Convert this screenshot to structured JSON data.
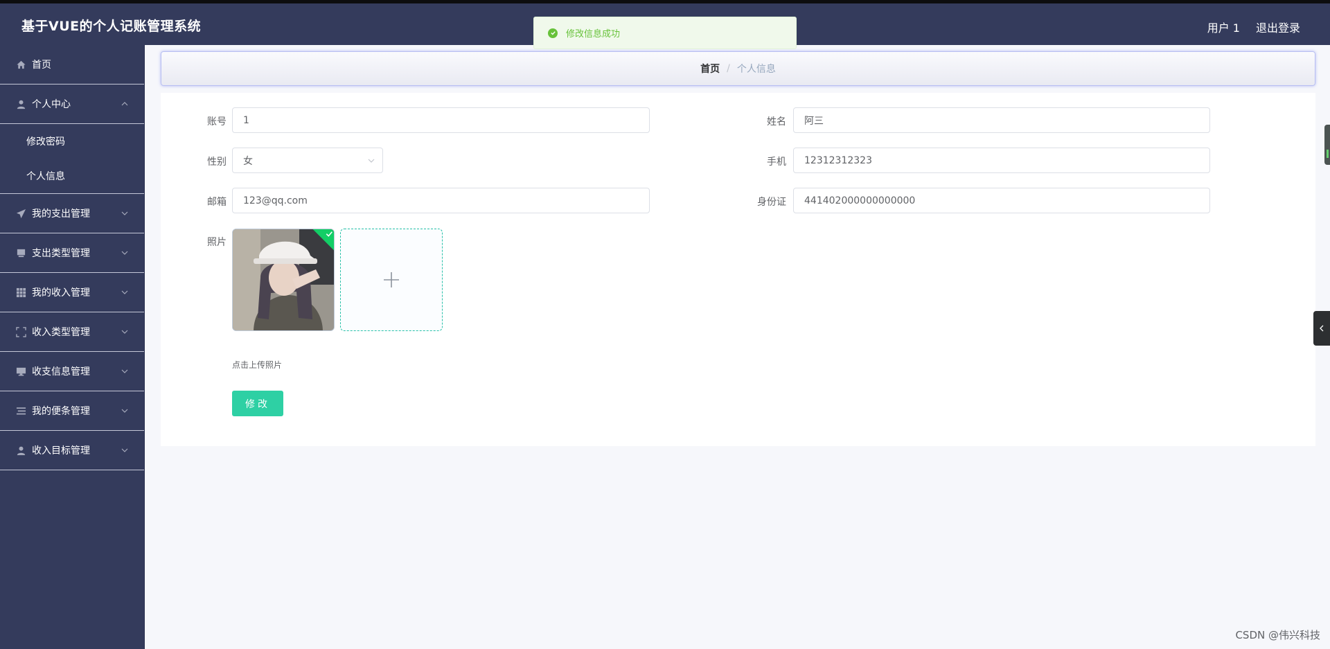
{
  "header": {
    "title": "基于VUE的个人记账管理系统",
    "user": "用户 1",
    "logout": "退出登录"
  },
  "toast": {
    "message": "修改信息成功"
  },
  "sidebar": {
    "home": "首页",
    "personal_center": "个人中心",
    "personal_sub": [
      "修改密码",
      "个人信息"
    ],
    "items": [
      "我的支出管理",
      "支出类型管理",
      "我的收入管理",
      "收入类型管理",
      "收支信息管理",
      "我的便条管理",
      "收入目标管理"
    ]
  },
  "breadcrumb": {
    "home": "首页",
    "separator": "/",
    "current": "个人信息"
  },
  "form": {
    "account_label": "账号",
    "account_value": "1",
    "name_label": "姓名",
    "name_value": "阿三",
    "gender_label": "性别",
    "gender_value": "女",
    "phone_label": "手机",
    "phone_value": "12312312323",
    "email_label": "邮箱",
    "email_value": "123@qq.com",
    "idcard_label": "身份证",
    "idcard_value": "441402000000000000",
    "photo_label": "照片",
    "upload_tip": "点击上传照片",
    "submit": "修改"
  },
  "watermark": "CSDN @伟兴科技",
  "colors": {
    "header_bg": "#343b5c",
    "primary_button": "#2ed0a4",
    "success": "#67c23a"
  }
}
